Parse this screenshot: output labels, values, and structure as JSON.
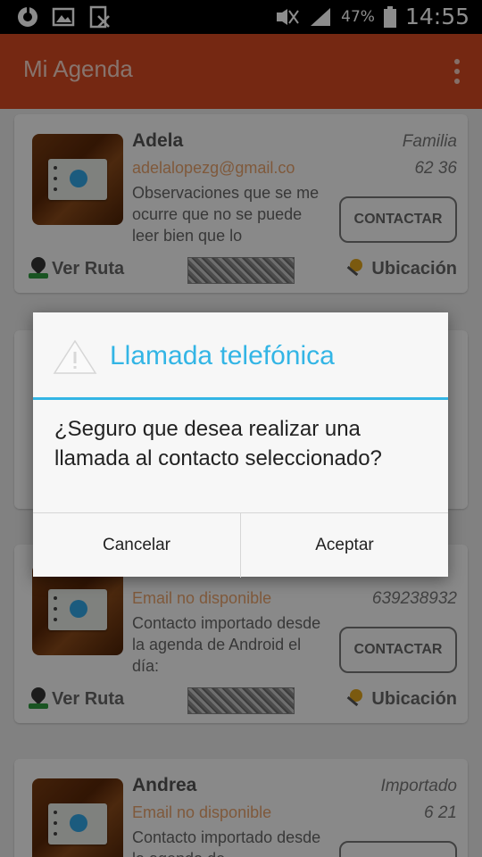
{
  "status_bar": {
    "battery_percent": "47%",
    "time": "14:55"
  },
  "app_bar": {
    "title": "Mi Agenda"
  },
  "contacts": [
    {
      "name": "Adela",
      "email": "adelalopezg@gmail.co",
      "observations": "Observaciones que se me ocurre que no se puede leer bien que lo",
      "group": "Familia",
      "phone": "62      36",
      "contact_label": "CONTACTAR",
      "route_label": "Ver Ruta",
      "location_label": "Ubicación"
    },
    {
      "name": "",
      "email": "",
      "observations": "",
      "group": "",
      "phone": "",
      "contact_label": "",
      "route_label": "",
      "location_label": ""
    },
    {
      "name": "",
      "email": "Email no disponible",
      "observations": "Contacto importado desde la agenda de Android el día:",
      "group": "",
      "phone": "639238932",
      "contact_label": "CONTACTAR",
      "route_label": "Ver Ruta",
      "location_label": "Ubicación"
    },
    {
      "name": "Andrea",
      "email": "Email no disponible",
      "observations": "Contacto importado desde la agenda de",
      "group": "Importado",
      "phone": "6       21",
      "contact_label": "",
      "route_label": "",
      "location_label": ""
    }
  ],
  "dialog": {
    "title": "Llamada telefónica",
    "message": "¿Seguro que desea realizar una llamada al contacto seleccionado?",
    "cancel_label": "Cancelar",
    "accept_label": "Aceptar"
  },
  "colors": {
    "app_bar": "#d64a22",
    "dialog_accent": "#33b5e5",
    "email_text": "#e8a26c"
  }
}
